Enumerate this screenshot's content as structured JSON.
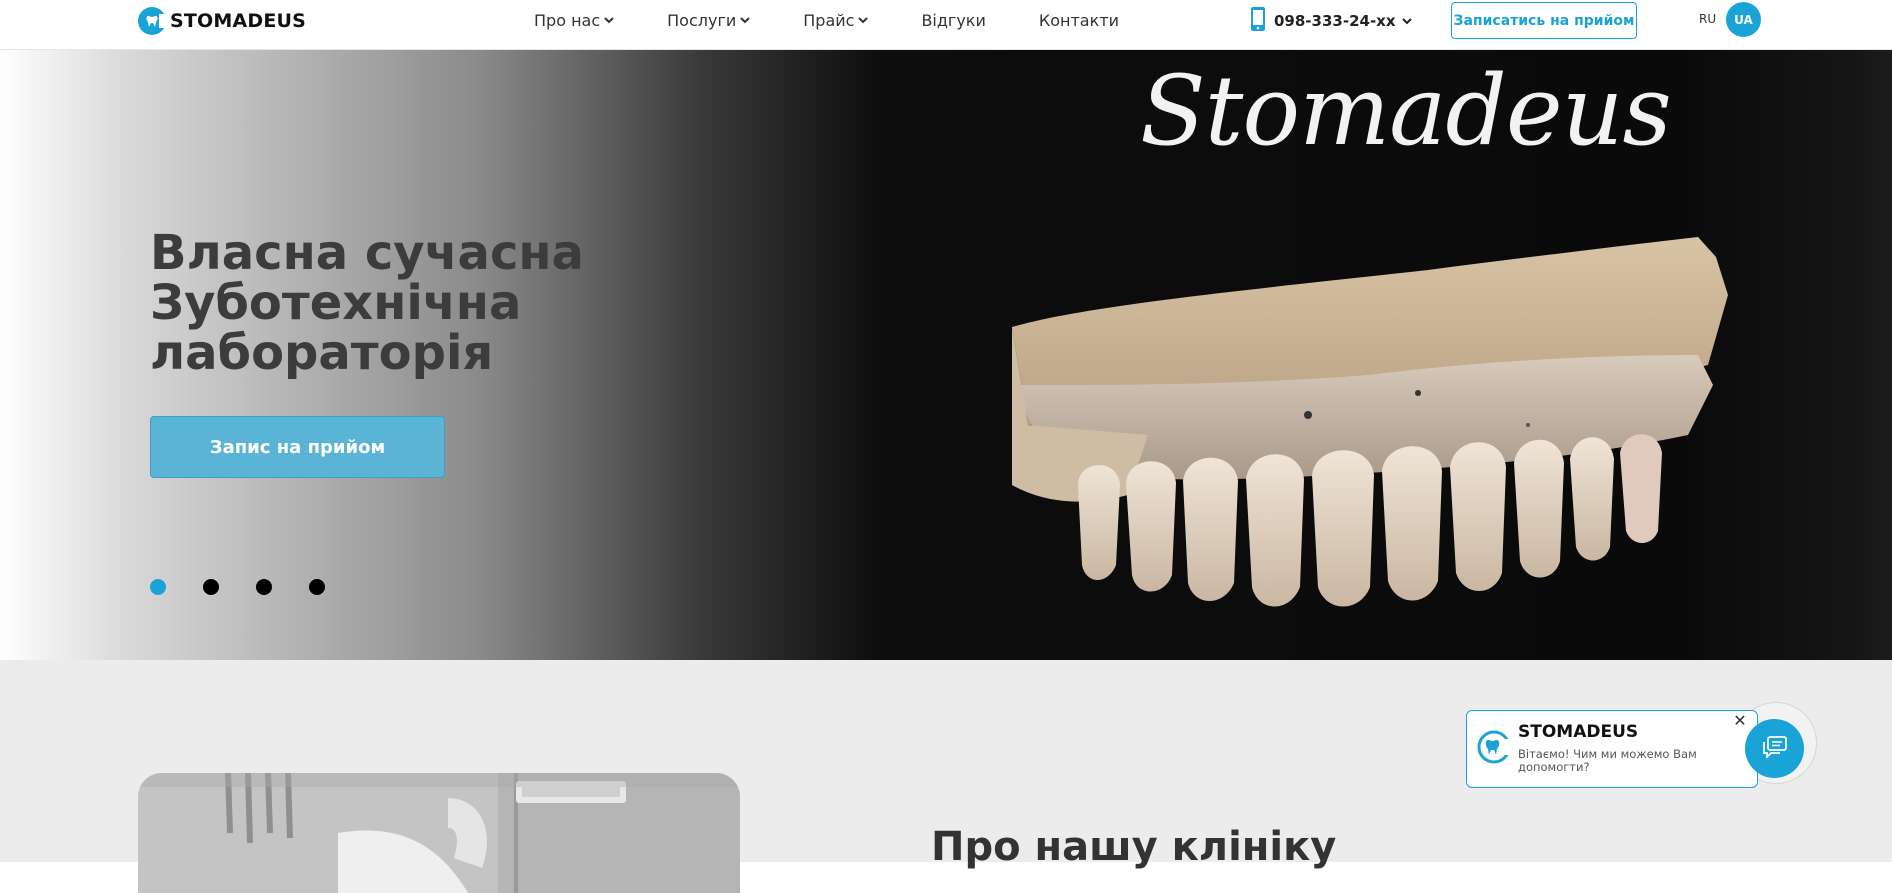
{
  "header": {
    "logo_text": "STOMADEUS",
    "nav": [
      {
        "label": "Про нас",
        "has_dropdown": true
      },
      {
        "label": "Послуги",
        "has_dropdown": true
      },
      {
        "label": "Прайс",
        "has_dropdown": true
      },
      {
        "label": "Відгуки",
        "has_dropdown": false
      },
      {
        "label": "Контакти",
        "has_dropdown": false
      }
    ],
    "phone": "098-333-24-xx",
    "book_button": "Записатись на прийом",
    "lang_ru": "RU",
    "lang_ua": "UA"
  },
  "hero": {
    "brand_script": "Stomadeus",
    "title_lines": [
      "Власна сучасна",
      "Зуботехнічна",
      "лабораторія"
    ],
    "cta": "Запис на прийом",
    "slides_total": 4,
    "active_slide": 1
  },
  "about": {
    "title": "Про нашу клініку"
  },
  "chat": {
    "title": "STOMADEUS",
    "message": "Вітаємо! Чим ми можемо Вам допомогти?",
    "close_symbol": "✕"
  },
  "icons": {
    "logo": "tooth-logo-icon",
    "phone": "phone-icon",
    "chevron": "chevron-down-icon",
    "chat": "chat-icon",
    "close": "close-icon"
  },
  "colors": {
    "accent": "#1aa3d6",
    "hero_button": "#5ab4d6",
    "hero_title": "#3c3c3c",
    "section_bg": "#ececec"
  }
}
